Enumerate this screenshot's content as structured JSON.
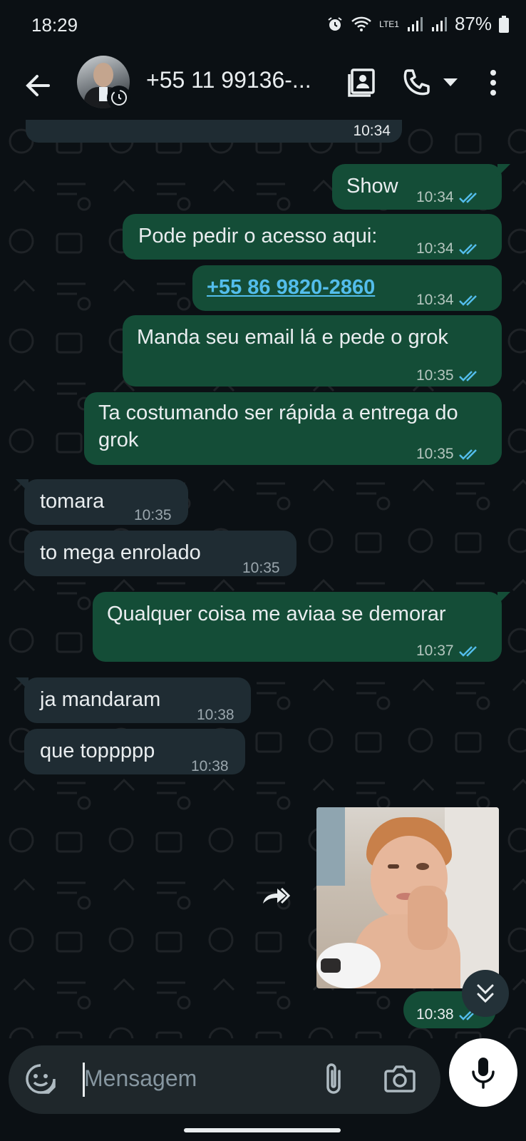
{
  "status_bar": {
    "time": "18:29",
    "battery": "87%",
    "network_label": "LTE1"
  },
  "header": {
    "contact": "+55 11 99136-..."
  },
  "messages": [
    {
      "dir": "out",
      "text": "Show",
      "time": "10:34"
    },
    {
      "dir": "out",
      "text": "Pode pedir o acesso aqui:",
      "time": "10:34"
    },
    {
      "dir": "out",
      "text": "+55 86 9820-2860",
      "time": "10:34",
      "link": true
    },
    {
      "dir": "out",
      "text": "Manda seu email lá e pede o grok",
      "time": "10:35"
    },
    {
      "dir": "out",
      "text": "Ta costumando ser rápida a entrega do grok",
      "time": "10:35"
    },
    {
      "dir": "in",
      "text": "tomara",
      "time": "10:35"
    },
    {
      "dir": "in",
      "text": "to mega enrolado",
      "time": "10:35"
    },
    {
      "dir": "out",
      "text": "Qualquer coisa me aviaa se demorar",
      "time": "10:37"
    },
    {
      "dir": "in",
      "text": "ja mandaram",
      "time": "10:38"
    },
    {
      "dir": "in",
      "text": "que toppppp",
      "time": "10:38"
    },
    {
      "dir": "out",
      "type": "sticker",
      "time": "10:38"
    }
  ],
  "previous_message_time": "10:34",
  "composer": {
    "placeholder": "Mensagem"
  },
  "colors": {
    "outgoing": "#144d37",
    "incoming": "#1f2c33",
    "read_ticks": "#53bdeb",
    "background": "#0b1014"
  },
  "icons": [
    "back-arrow-icon",
    "contact-card-icon",
    "phone-icon",
    "dropdown-icon",
    "more-vert-icon",
    "sticker-icon",
    "attach-icon",
    "camera-icon",
    "mic-icon",
    "forward-icon",
    "scroll-down-icon"
  ]
}
